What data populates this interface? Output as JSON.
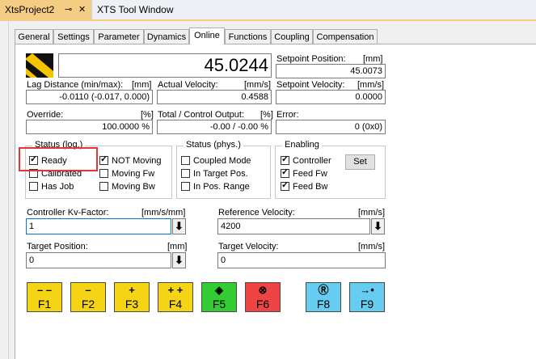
{
  "doc_tabs": [
    {
      "label": "XtsProject2",
      "active": true
    },
    {
      "label": "XTS Tool Window",
      "active": false
    }
  ],
  "tabs": [
    "General",
    "Settings",
    "Parameter",
    "Dynamics",
    "Online",
    "Functions",
    "Coupling",
    "Compensation"
  ],
  "active_tab": "Online",
  "position_display": "45.0244",
  "setpoint_position": {
    "label": "Setpoint Position:",
    "unit": "[mm]",
    "value": "45.0073"
  },
  "lag_distance": {
    "label": "Lag Distance (min/max):",
    "unit": "[mm]",
    "value": "-0.0110  (-0.017, 0.000)"
  },
  "actual_velocity": {
    "label": "Actual Velocity:",
    "unit": "[mm/s]",
    "value": "0.4588"
  },
  "setpoint_velocity": {
    "label": "Setpoint Velocity:",
    "unit": "[mm/s]",
    "value": "0.0000"
  },
  "override": {
    "label": "Override:",
    "unit": "[%]",
    "value": "100.0000 %"
  },
  "total_output": {
    "label": "Total / Control Output:",
    "unit": "[%]",
    "value": "-0.00 / -0.00 %"
  },
  "error": {
    "label": "Error:",
    "value": "0 (0x0)"
  },
  "status_log": {
    "title": "Status (log.)",
    "items": [
      {
        "label": "Ready",
        "checked": true
      },
      {
        "label": "NOT Moving",
        "checked": true
      },
      {
        "label": "Calibrated",
        "checked": false
      },
      {
        "label": "Moving Fw",
        "checked": false
      },
      {
        "label": "Has Job",
        "checked": false
      },
      {
        "label": "Moving Bw",
        "checked": false
      }
    ]
  },
  "status_phys": {
    "title": "Status (phys.)",
    "items": [
      {
        "label": "Coupled Mode",
        "checked": false
      },
      {
        "label": "In Target Pos.",
        "checked": false
      },
      {
        "label": "In Pos. Range",
        "checked": false
      }
    ]
  },
  "enabling": {
    "title": "Enabling",
    "items": [
      {
        "label": "Controller",
        "checked": true
      },
      {
        "label": "Feed Fw",
        "checked": true
      },
      {
        "label": "Feed Bw",
        "checked": true
      }
    ],
    "set_label": "Set"
  },
  "kv_factor": {
    "label": "Controller Kv-Factor:",
    "unit": "[mm/s/mm]",
    "value": "1"
  },
  "reference_velocity": {
    "label": "Reference Velocity:",
    "unit": "[mm/s]",
    "value": "4200"
  },
  "target_position": {
    "label": "Target Position:",
    "unit": "[mm]",
    "value": "0"
  },
  "target_velocity": {
    "label": "Target Velocity:",
    "unit": "[mm/s]",
    "value": "0"
  },
  "fkeys": [
    {
      "label": "F1",
      "symbol": "– –",
      "color": "#f5d315"
    },
    {
      "label": "F2",
      "symbol": "–",
      "color": "#f5d315"
    },
    {
      "label": "F3",
      "symbol": "+",
      "color": "#f5d315"
    },
    {
      "label": "F4",
      "symbol": "+ +",
      "color": "#f5d315"
    },
    {
      "label": "F5",
      "symbol": "◈",
      "color": "#33cc33"
    },
    {
      "label": "F6",
      "symbol": "⊗",
      "color": "#ee4444"
    },
    {
      "label": "F8",
      "symbol": "Ⓡ",
      "color": "#66ccf0"
    },
    {
      "label": "F9",
      "symbol": "→•",
      "color": "#66ccf0"
    }
  ],
  "colors": {
    "doc_tab_active": "#f5cc84",
    "highlight": "#e53535"
  }
}
